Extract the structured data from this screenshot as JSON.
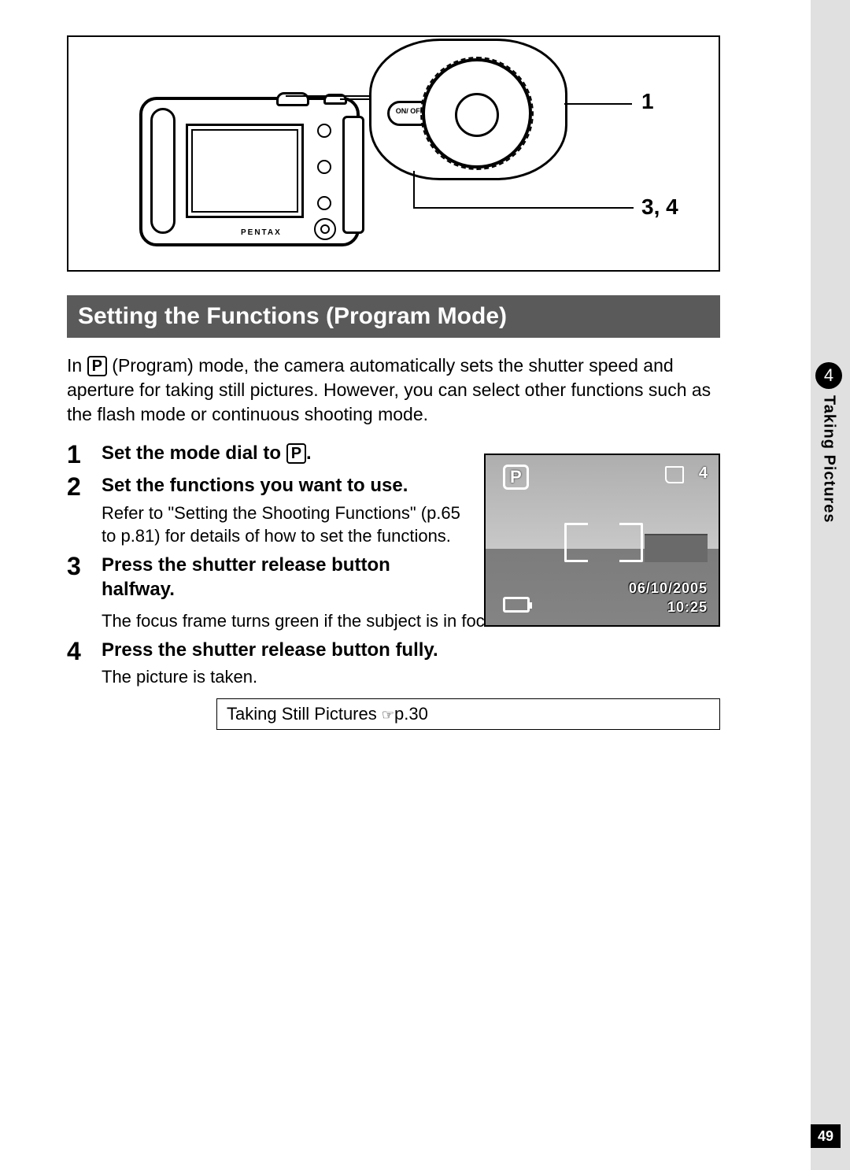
{
  "diagram": {
    "callout1": "1",
    "callout2": "3, 4",
    "power": "ON/\nOFF",
    "brand": "PENTAX"
  },
  "section_title": "Setting the Functions (Program Mode)",
  "intro": {
    "pre": "In ",
    "p_icon": "P",
    "post": " (Program) mode, the camera automatically sets the shutter speed and aperture for taking still pictures. However, you can select other functions such as the flash mode or continuous shooting mode."
  },
  "steps": [
    {
      "num": "1",
      "head_pre": "Set the mode dial to ",
      "head_icon": "P",
      "head_post": ".",
      "body": ""
    },
    {
      "num": "2",
      "head": "Set the functions you want to use.",
      "body": "Refer to \"Setting the Shooting Functions\" (p.65 to p.81) for details of how to set the functions."
    },
    {
      "num": "3",
      "head": "Press the shutter release button halfway.",
      "body": "The focus frame turns green if the subject is in focus."
    },
    {
      "num": "4",
      "head": "Press the shutter release button fully.",
      "body": "The picture is taken."
    }
  ],
  "lcd": {
    "mode": "P",
    "shots": "4",
    "date": "06/10/2005",
    "time": "10:25"
  },
  "ref": {
    "text": "Taking Still Pictures ",
    "page": "p.30"
  },
  "side": {
    "chapter": "4",
    "title": "Taking Pictures"
  },
  "page_number": "49"
}
